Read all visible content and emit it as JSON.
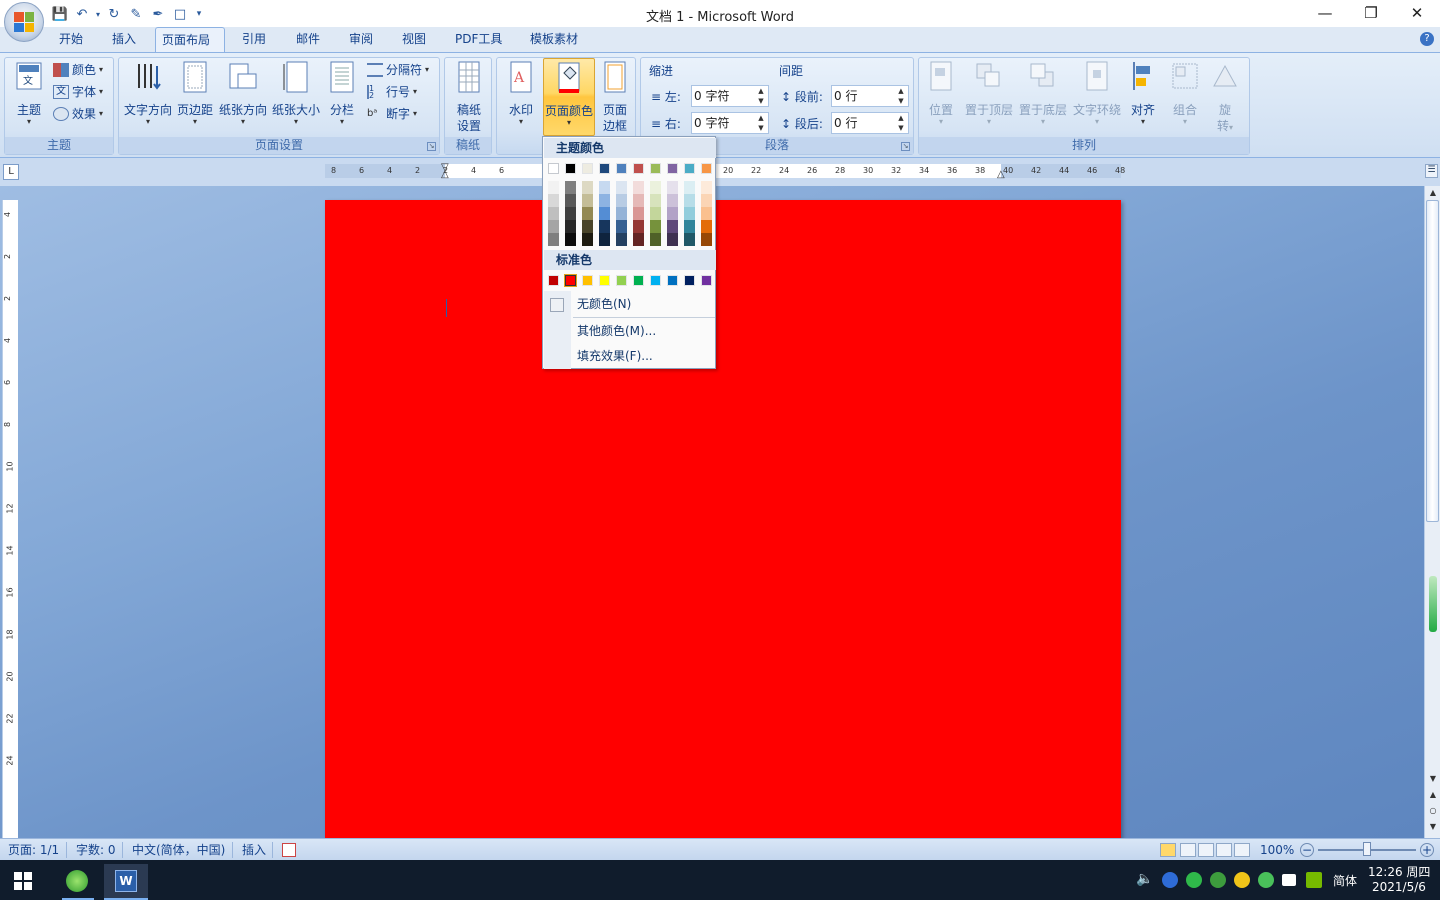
{
  "window": {
    "title": "文档 1 - Microsoft Word",
    "controls": [
      "—",
      "❐",
      "✕"
    ]
  },
  "tabs": [
    "开始",
    "插入",
    "页面布局",
    "引用",
    "邮件",
    "审阅",
    "视图",
    "PDF工具",
    "模板素材"
  ],
  "active_tab": "页面布局",
  "ribbon": {
    "themes": {
      "label": "主题",
      "big": "主题",
      "colors": "颜色",
      "fonts": "字体",
      "effects": "效果"
    },
    "page_setup": {
      "label": "页面设置",
      "text_direction": "文字方向",
      "margins": "页边距",
      "orientation": "纸张方向",
      "size": "纸张大小",
      "columns": "分栏",
      "breaks": "分隔符",
      "line_numbers": "行号",
      "hyphenation": "断字"
    },
    "manuscript": {
      "label": "稿纸",
      "settings_line1": "稿纸",
      "settings_line2": "设置"
    },
    "background": {
      "watermark": "水印",
      "page_color": "页面颜色",
      "page_borders_line1": "页面",
      "page_borders_line2": "边框"
    },
    "paragraph": {
      "label": "段落",
      "indent": "缩进",
      "indent_left_label": "左:",
      "indent_left_value": "0 字符",
      "indent_right_label": "右:",
      "indent_right_value": "0 字符",
      "spacing": "间距",
      "before_label": "段前:",
      "before_value": "0 行",
      "after_label": "段后:",
      "after_value": "0 行"
    },
    "arrange": {
      "label": "排列",
      "position": "位置",
      "bring_front": "置于顶层",
      "send_back": "置于底层",
      "wrap": "文字环绕",
      "align": "对齐",
      "group": "组合",
      "rotate_line1": "旋",
      "rotate_line2": "转"
    }
  },
  "ruler": {
    "ticks": [
      "8",
      "6",
      "4",
      "2",
      "2",
      "4",
      "6",
      "20",
      "22",
      "24",
      "26",
      "28",
      "30",
      "32",
      "34",
      "36",
      "38",
      "40",
      "42",
      "44",
      "46",
      "48"
    ],
    "vticks": [
      "4",
      "2",
      "2",
      "4",
      "6",
      "8",
      "10",
      "12",
      "14",
      "16",
      "18",
      "20",
      "22",
      "24"
    ]
  },
  "color_popup": {
    "theme_header": "主题颜色",
    "standard_header": "标准色",
    "theme_top": [
      "#ffffff",
      "#000000",
      "#eeece1",
      "#1f497d",
      "#4f81bd",
      "#c0504d",
      "#9bbb59",
      "#8064a2",
      "#4bacc6",
      "#f79646"
    ],
    "theme_shades": [
      [
        "#f2f2f2",
        "#7f7f7f",
        "#ddd9c3",
        "#c6d9f0",
        "#dbe5f1",
        "#f2dcdb",
        "#ebf1dd",
        "#e5e0ec",
        "#dbeef3",
        "#fdeada"
      ],
      [
        "#d8d8d8",
        "#595959",
        "#c4bd97",
        "#8db3e2",
        "#b8cce4",
        "#e5b9b7",
        "#d7e3bc",
        "#ccc1d9",
        "#b7dde8",
        "#fbd5b5"
      ],
      [
        "#bfbfbf",
        "#3f3f3f",
        "#938953",
        "#548dd4",
        "#95b3d7",
        "#d99694",
        "#c3d69b",
        "#b2a2c7",
        "#92cddc",
        "#fac08f"
      ],
      [
        "#a5a5a5",
        "#262626",
        "#494429",
        "#17365d",
        "#366092",
        "#953734",
        "#76923c",
        "#5f497a",
        "#31859b",
        "#e36c09"
      ],
      [
        "#7f7f7f",
        "#0c0c0c",
        "#1d1b10",
        "#0f243e",
        "#244061",
        "#632423",
        "#4f6128",
        "#3f3151",
        "#205867",
        "#974806"
      ]
    ],
    "standard": [
      "#c00000",
      "#ff0000",
      "#ffc000",
      "#ffff00",
      "#92d050",
      "#00b050",
      "#00b0f0",
      "#0070c0",
      "#002060",
      "#7030a0"
    ],
    "no_color": "无颜色(N)",
    "more_colors": "其他颜色(M)...",
    "fill_effects": "填充效果(F)..."
  },
  "document": {
    "page_color": "#ff0000"
  },
  "statusbar": {
    "page": "页面: 1/1",
    "words": "字数: 0",
    "language": "中文(简体，中国)",
    "mode": "插入",
    "zoom": "100%"
  },
  "taskbar": {
    "ime": "简体",
    "time": "12:26 周四",
    "date": "2021/5/6"
  }
}
